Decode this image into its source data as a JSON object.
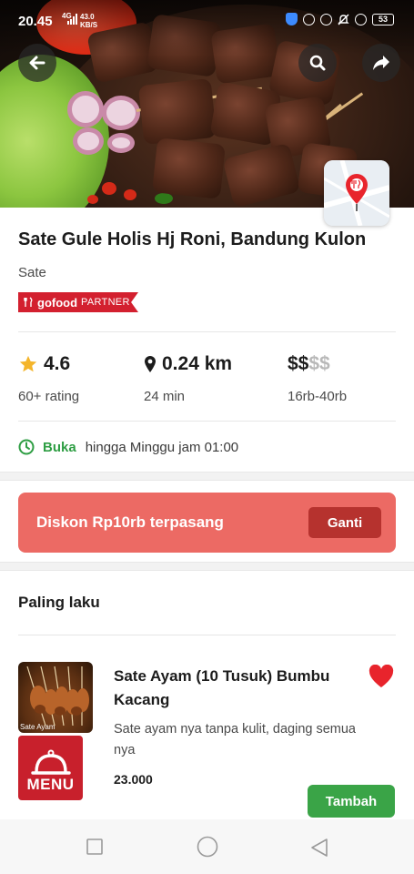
{
  "status_bar": {
    "time": "20.45",
    "network": "4G",
    "speed_value": "43.0",
    "speed_unit": "KB/S",
    "battery": "53"
  },
  "header": {
    "back_icon": "arrow-left-icon",
    "search_icon": "search-icon",
    "share_icon": "share-icon",
    "map_icon": "map-pin-icon"
  },
  "restaurant": {
    "name": "Sate Gule Holis Hj Roni, Bandung Kulon",
    "category": "Sate",
    "partner_badge": {
      "brand": "gofood",
      "label": "PARTNER",
      "color": "#d3202f"
    }
  },
  "stats": {
    "rating_value": "4.6",
    "rating_count": "60+ rating",
    "distance": "0.24 km",
    "time": "24 min",
    "price_active": "$$",
    "price_inactive": "$$",
    "price_range": "16rb-40rb"
  },
  "hours": {
    "status": "Buka",
    "until": "hingga Minggu jam 01:00",
    "color": "#2f9e44"
  },
  "promo": {
    "text": "Diskon Rp10rb terpasang",
    "button": "Ganti",
    "color": "#ec6a64"
  },
  "section": {
    "title": "Paling laku"
  },
  "items": [
    {
      "image_label": "Sate Ayam",
      "menu_badge": "MENU",
      "name": "Sate Ayam (10 Tusuk) Bumbu Kacang",
      "description": "Sate ayam nya tanpa kulit, daging semua nya",
      "price": "23.000",
      "add_button": "Tambah",
      "favorite": true
    }
  ],
  "colors": {
    "accent_green": "#3aa447",
    "gojek_red": "#c8202c",
    "favorite_red": "#e8242c"
  }
}
